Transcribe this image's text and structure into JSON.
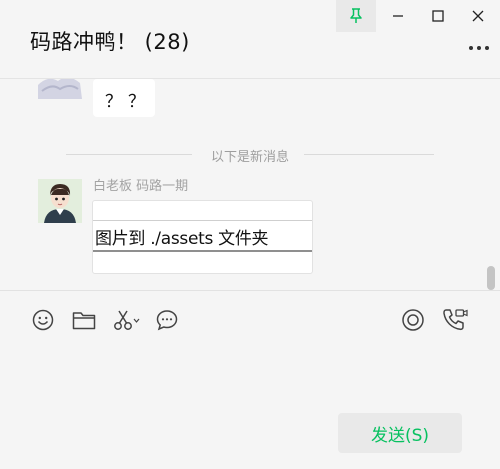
{
  "window": {
    "title": "码路冲鸭！ (28)",
    "accent_color": "#07c160",
    "controls": [
      "pin-icon",
      "minimize-icon",
      "maximize-icon",
      "close-icon",
      "more-icon"
    ]
  },
  "messages": {
    "previous_bubble_text": "？？",
    "divider_text": "以下是新消息",
    "latest": {
      "sender": "白老板  码路一期",
      "card_text": "图片到 ./assets 文件夹"
    }
  },
  "toolbar": {
    "left_icons": [
      "emoji-icon",
      "folder-icon",
      "scissors-icon",
      "chat-bubble-icon"
    ],
    "right_icons": [
      "live-icon",
      "call-icon"
    ]
  },
  "send_button": {
    "label": "发送(S)"
  }
}
